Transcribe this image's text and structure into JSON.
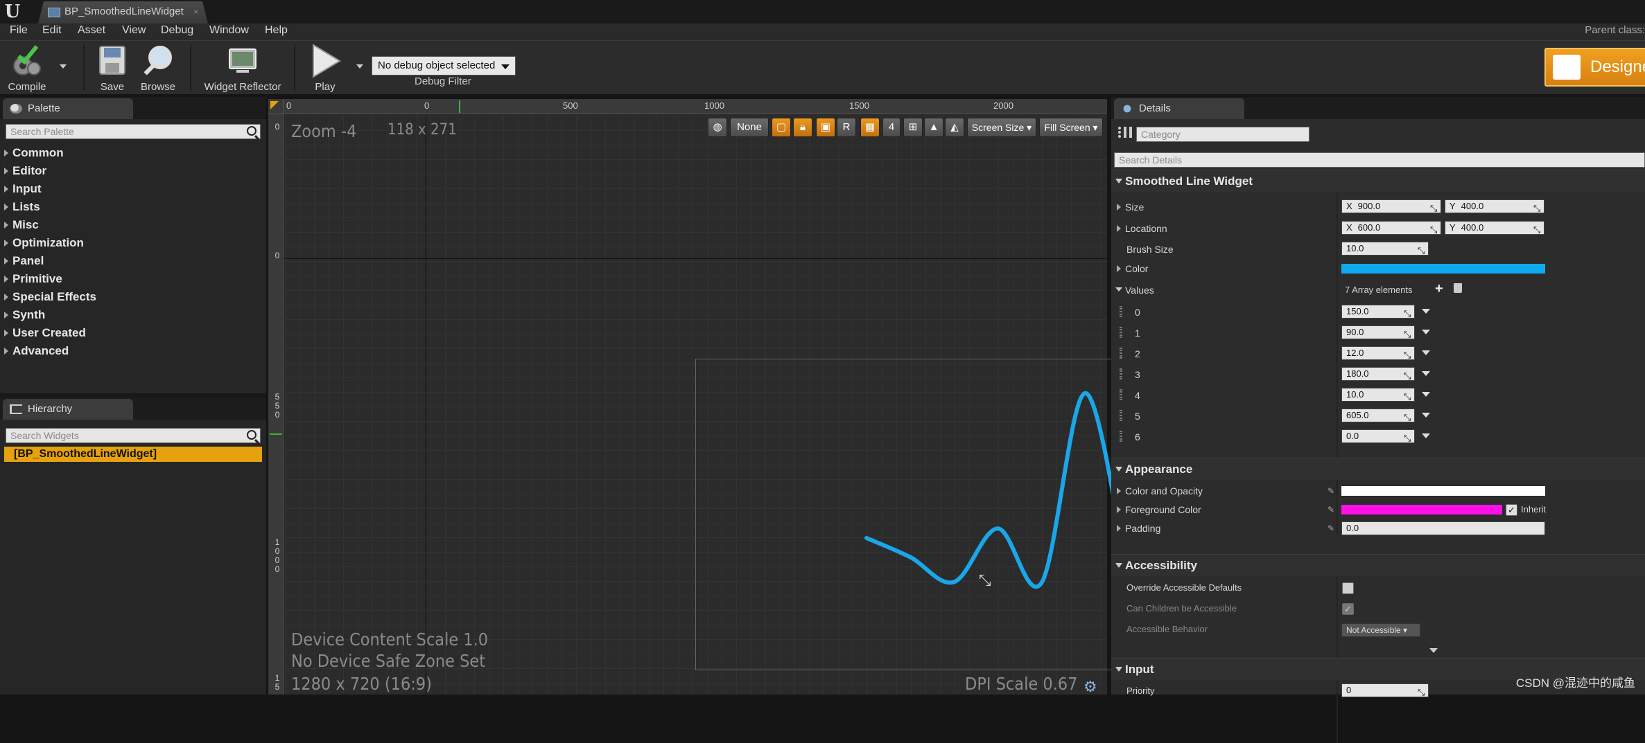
{
  "window": {
    "doc_tab": "BP_SmoothedLineWidget",
    "parent_class_label": "Parent class:"
  },
  "menu": [
    "File",
    "Edit",
    "Asset",
    "View",
    "Debug",
    "Window",
    "Help"
  ],
  "toolbar": {
    "compile": "Compile",
    "save": "Save",
    "browse": "Browse",
    "widget_reflector": "Widget Reflector",
    "play": "Play",
    "debug_object": "No debug object selected",
    "debug_filter": "Debug Filter",
    "designer": "Designer"
  },
  "palette": {
    "tab": "Palette",
    "search_placeholder": "Search Palette",
    "categories": [
      "Common",
      "Editor",
      "Input",
      "Lists",
      "Misc",
      "Optimization",
      "Panel",
      "Primitive",
      "Special Effects",
      "Synth",
      "User Created",
      "Advanced"
    ]
  },
  "hierarchy": {
    "tab": "Hierarchy",
    "search_placeholder": "Search Widgets",
    "root": "[BP_SmoothedLineWidget]"
  },
  "viewport": {
    "zoom": "Zoom -4",
    "size": "118 x 271",
    "ruler_top": [
      "0",
      "0",
      "500",
      "1000",
      "1500",
      "2000"
    ],
    "ruler_left": [
      "0",
      "0",
      "5 5 0",
      "1 0 0 0",
      "1 5"
    ],
    "toolbar": {
      "none": "None",
      "r": "R",
      "grid_value": "4",
      "screen_size": "Screen Size",
      "fill_screen": "Fill Screen"
    },
    "device_content_scale": "Device Content Scale 1.0",
    "safe_zone": "No Device Safe Zone Set",
    "resolution": "1280 x 720 (16:9)",
    "dpi_scale": "DPI Scale 0.67",
    "line_color": "#1aa6e8",
    "line_values": [
      150,
      90,
      12,
      180,
      10,
      605,
      0
    ]
  },
  "details": {
    "tab": "Details",
    "category_placeholder": "Category",
    "search_placeholder": "Search Details",
    "smoothed_section": "Smoothed Line Widget",
    "size": {
      "label": "Size",
      "x": "900.0",
      "y": "400.0"
    },
    "location": {
      "label": "Locationn",
      "x": "600.0",
      "y": "400.0"
    },
    "brush_size": {
      "label": "Brush Size",
      "value": "10.0"
    },
    "color": {
      "label": "Color",
      "value": "#11aaee"
    },
    "values": {
      "label": "Values",
      "count": "7 Array elements"
    },
    "value_items": [
      {
        "index": "0",
        "value": "150.0"
      },
      {
        "index": "1",
        "value": "90.0"
      },
      {
        "index": "2",
        "value": "12.0"
      },
      {
        "index": "3",
        "value": "180.0"
      },
      {
        "index": "4",
        "value": "10.0"
      },
      {
        "index": "5",
        "value": "605.0"
      },
      {
        "index": "6",
        "value": "0.0"
      }
    ],
    "appearance_section": "Appearance",
    "color_opacity": {
      "label": "Color and Opacity",
      "value": "#ffffff"
    },
    "foreground": {
      "label": "Foreground Color",
      "value": "#ff10e8",
      "inherit": "Inherit"
    },
    "padding": {
      "label": "Padding",
      "value": "0.0"
    },
    "accessibility_section": "Accessibility",
    "override_defaults": "Override Accessible Defaults",
    "children_accessible": "Can Children be Accessible",
    "accessible_behavior": {
      "label": "Accessible Behavior",
      "value": "Not Accessible"
    },
    "input_section": "Input",
    "priority": {
      "label": "Priority",
      "value": "0"
    }
  },
  "watermark": "CSDN @混迹中的咸鱼"
}
